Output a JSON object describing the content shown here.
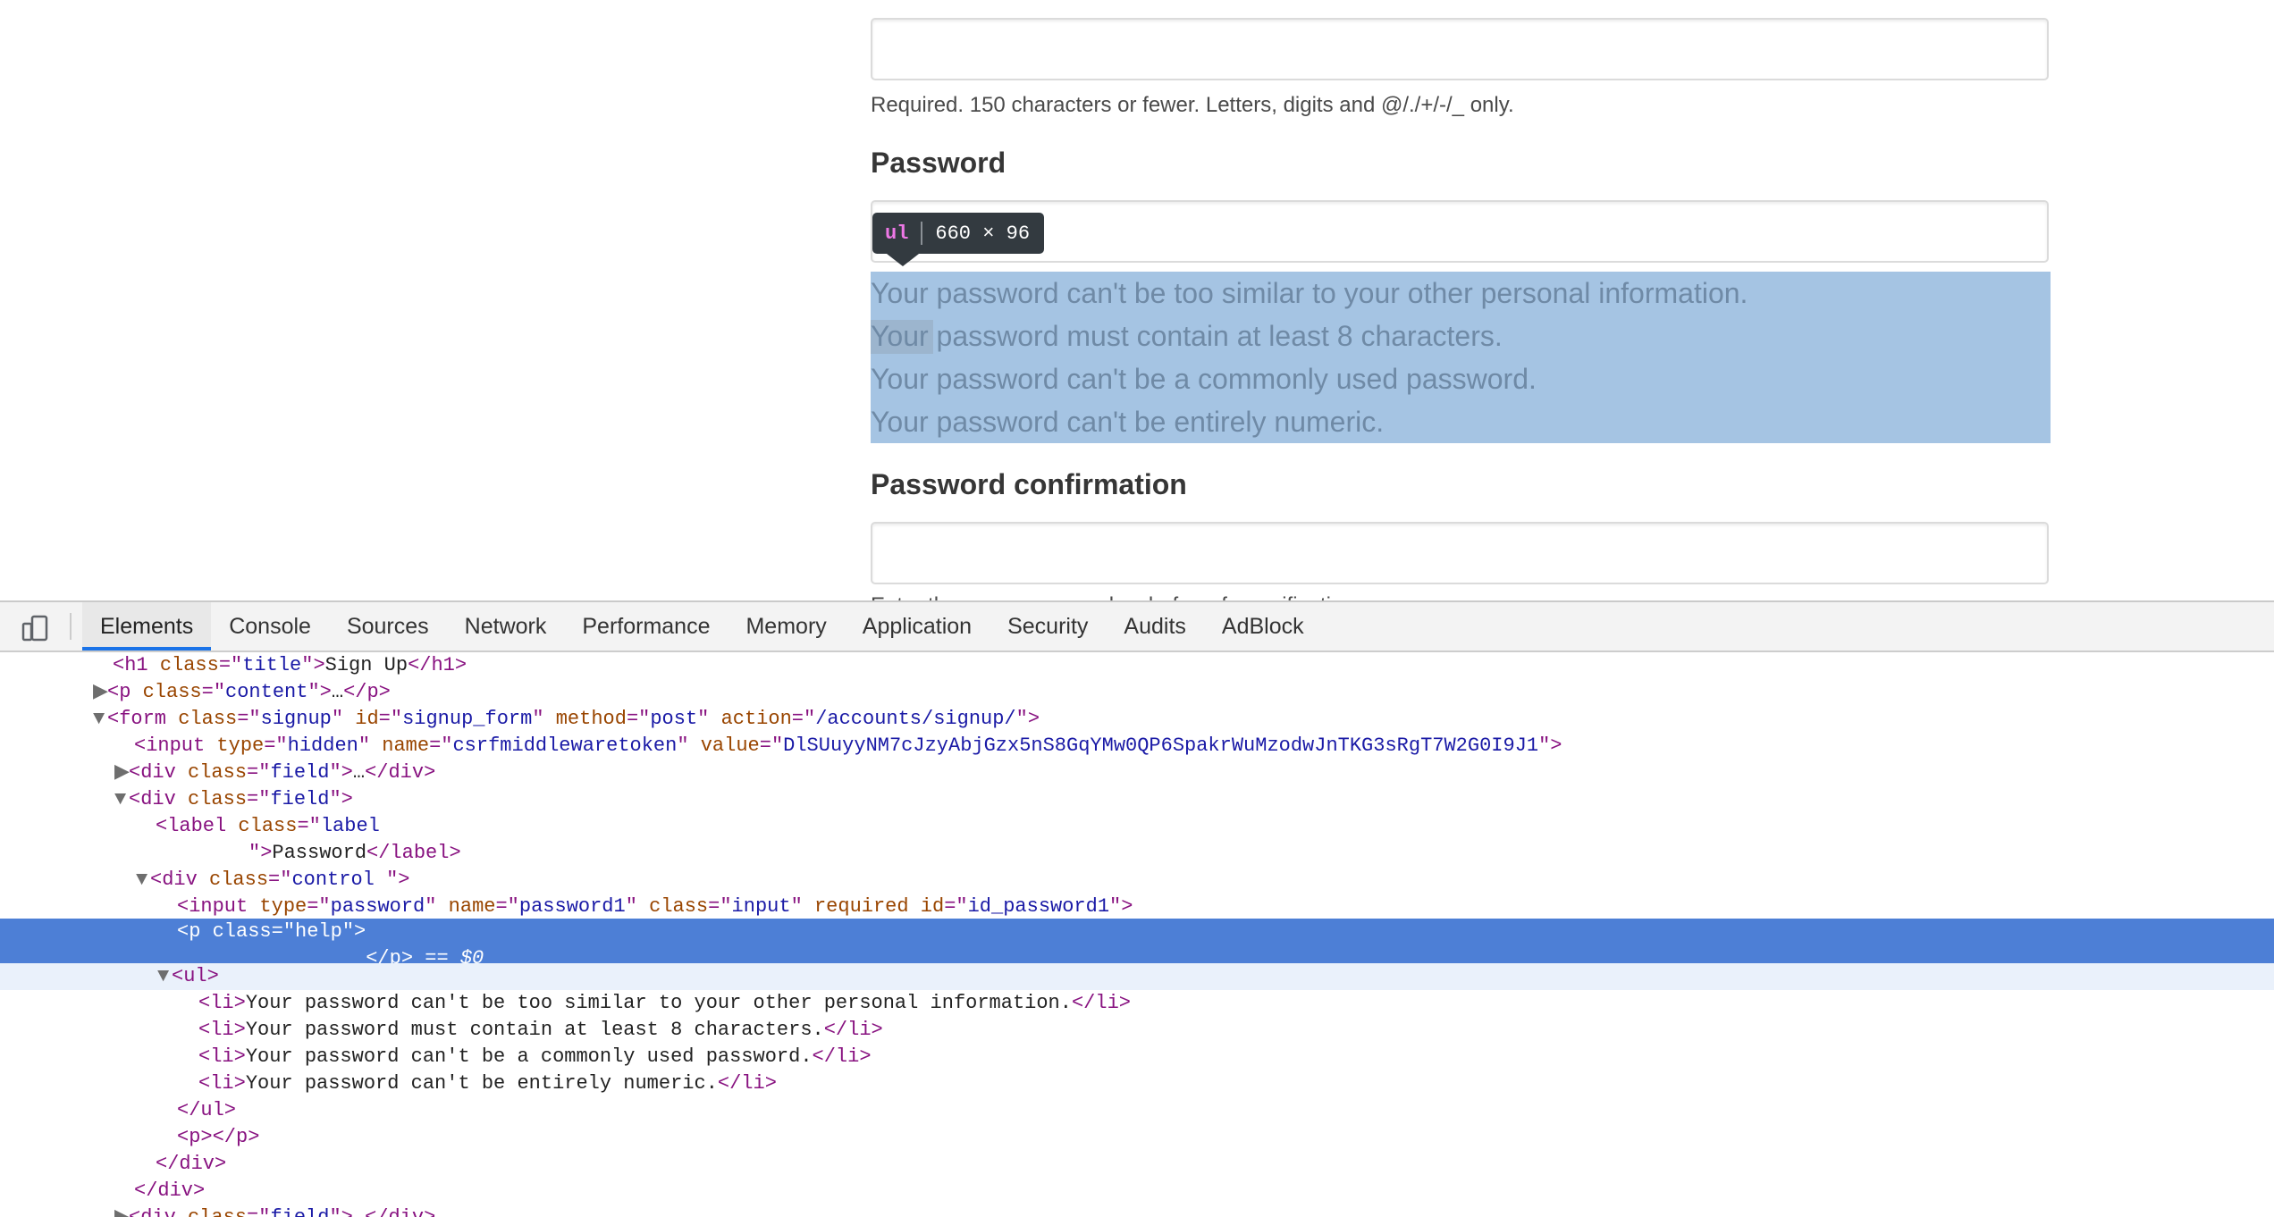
{
  "form": {
    "username_help": "Required. 150 characters or fewer. Letters, digits and @/./+/-/_ only.",
    "password_label": "Password",
    "password_rules": [
      "Your password can't be too similar to your other personal information.",
      "Your password must contain at least 8 characters.",
      "Your password can't be a commonly used password.",
      "Your password can't be entirely numeric."
    ],
    "confirm_label": "Password confirmation",
    "confirm_help_partial": "Enter the same password as before, for verification."
  },
  "inspector_tooltip": {
    "tag": "ul",
    "size": "660 × 96"
  },
  "devtools": {
    "tabs": [
      "Elements",
      "Console",
      "Sources",
      "Network",
      "Performance",
      "Memory",
      "Application",
      "Security",
      "Audits",
      "AdBlock"
    ],
    "active_tab": "Elements",
    "dom": {
      "h1_title": "Sign Up",
      "ellipsis": "…",
      "form_class": "signup",
      "form_id": "signup_form",
      "form_method": "post",
      "form_action": "/accounts/signup/",
      "csrf_name": "csrfmiddlewaretoken",
      "csrf_value": "DlSUuyyNM7cJzyAbjGzx5nS8GqYMw0QP6SpakrWuMzodwJnTKG3sRgT7W2G0I9J1",
      "label_text": "Password",
      "input_name": "password1",
      "input_class": "input",
      "input_id": "id_password1",
      "help_class": "help",
      "selected_marker": "== $0"
    }
  }
}
